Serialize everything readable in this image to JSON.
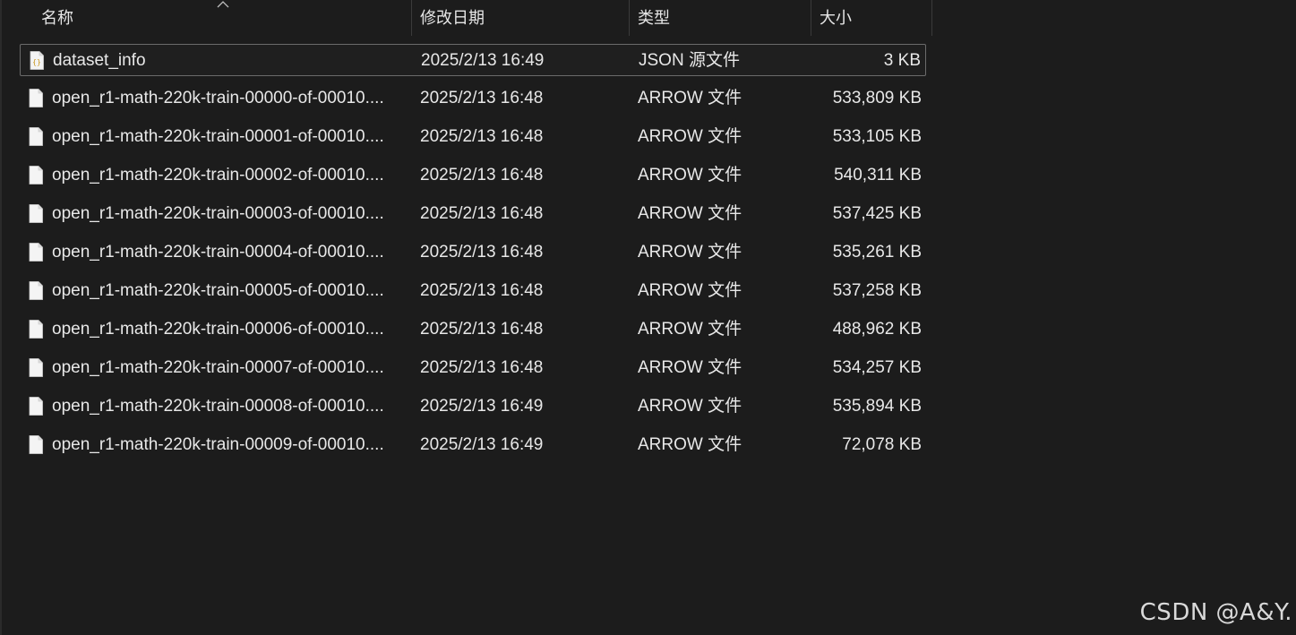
{
  "columns": {
    "name": "名称",
    "date_modified": "修改日期",
    "type": "类型",
    "size": "大小"
  },
  "sort": {
    "column": "name",
    "icon": "sort-ascending-icon"
  },
  "files": [
    {
      "name": "dataset_info",
      "date": "2025/2/13 16:49",
      "type": "JSON 源文件",
      "size": "3 KB",
      "icon": "json-file-icon",
      "selected": true
    },
    {
      "name": "open_r1-math-220k-train-00000-of-00010....",
      "date": "2025/2/13 16:48",
      "type": "ARROW 文件",
      "size": "533,809 KB",
      "icon": "file-icon",
      "selected": false
    },
    {
      "name": "open_r1-math-220k-train-00001-of-00010....",
      "date": "2025/2/13 16:48",
      "type": "ARROW 文件",
      "size": "533,105 KB",
      "icon": "file-icon",
      "selected": false
    },
    {
      "name": "open_r1-math-220k-train-00002-of-00010....",
      "date": "2025/2/13 16:48",
      "type": "ARROW 文件",
      "size": "540,311 KB",
      "icon": "file-icon",
      "selected": false
    },
    {
      "name": "open_r1-math-220k-train-00003-of-00010....",
      "date": "2025/2/13 16:48",
      "type": "ARROW 文件",
      "size": "537,425 KB",
      "icon": "file-icon",
      "selected": false
    },
    {
      "name": "open_r1-math-220k-train-00004-of-00010....",
      "date": "2025/2/13 16:48",
      "type": "ARROW 文件",
      "size": "535,261 KB",
      "icon": "file-icon",
      "selected": false
    },
    {
      "name": "open_r1-math-220k-train-00005-of-00010....",
      "date": "2025/2/13 16:48",
      "type": "ARROW 文件",
      "size": "537,258 KB",
      "icon": "file-icon",
      "selected": false
    },
    {
      "name": "open_r1-math-220k-train-00006-of-00010....",
      "date": "2025/2/13 16:48",
      "type": "ARROW 文件",
      "size": "488,962 KB",
      "icon": "file-icon",
      "selected": false
    },
    {
      "name": "open_r1-math-220k-train-00007-of-00010....",
      "date": "2025/2/13 16:48",
      "type": "ARROW 文件",
      "size": "534,257 KB",
      "icon": "file-icon",
      "selected": false
    },
    {
      "name": "open_r1-math-220k-train-00008-of-00010....",
      "date": "2025/2/13 16:49",
      "type": "ARROW 文件",
      "size": "535,894 KB",
      "icon": "file-icon",
      "selected": false
    },
    {
      "name": "open_r1-math-220k-train-00009-of-00010....",
      "date": "2025/2/13 16:49",
      "type": "ARROW 文件",
      "size": "72,078 KB",
      "icon": "file-icon",
      "selected": false
    }
  ],
  "watermark": "CSDN @A&Y.",
  "colors": {
    "background": "#1c1c1c",
    "text": "#e8e8e8",
    "json_icon_accent": "#d4a72c",
    "selection_border": "#6b6b6b"
  }
}
